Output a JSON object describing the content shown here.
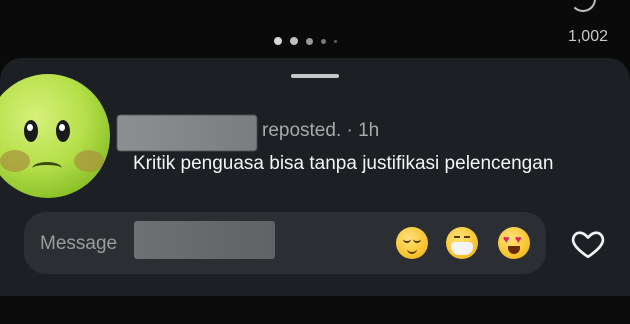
{
  "feed": {
    "view_count": "1,002",
    "carousel_dots": 5
  },
  "sheet": {
    "repost_meta": "reposted. · 1h",
    "post_text": "Kritik penguasa bisa tanpa justifikasi pelencengan",
    "message_placeholder": "Message",
    "quick_reactions": [
      "relieved-face-icon",
      "face-with-mask-icon",
      "heart-eyes-icon"
    ],
    "like_icon": "heart-outline-icon"
  },
  "colors": {
    "sheet_bg": "#1c1f23",
    "input_bg": "#2b2e33",
    "meta_text": "#a8a8a8"
  }
}
